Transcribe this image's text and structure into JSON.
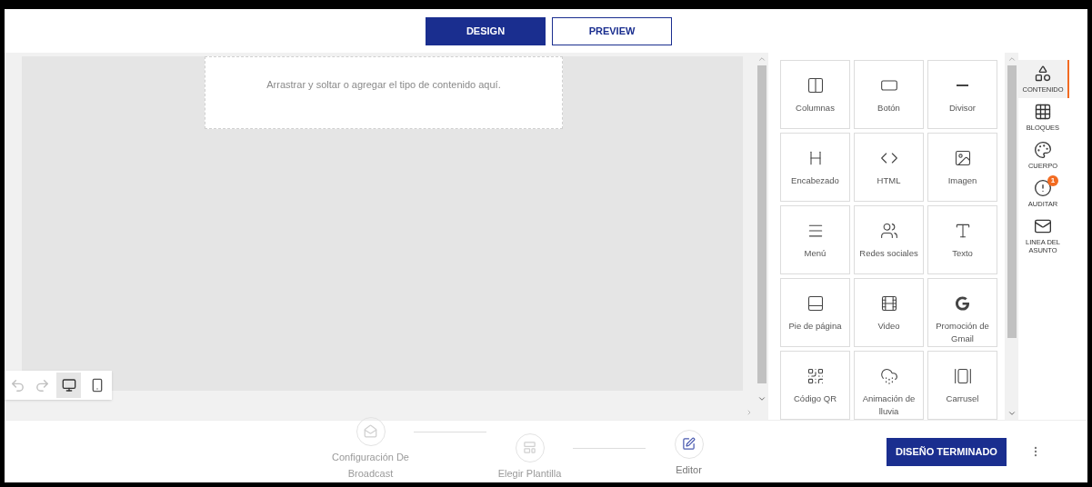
{
  "tabs": [
    {
      "label": "DESIGN",
      "selected": true
    },
    {
      "label": "PREVIEW",
      "selected": false
    }
  ],
  "canvas": {
    "placeholder_text": "Arrastrar y soltar o agregar el tipo de contenido aquí."
  },
  "view_toggle": [
    {
      "selected": true
    },
    {
      "selected": false
    }
  ],
  "content_tiles": [
    {
      "label": "Columnas"
    },
    {
      "label": "Botón"
    },
    {
      "label": "Divisor"
    },
    {
      "label": "Encabezado"
    },
    {
      "label": "HTML"
    },
    {
      "label": "Imagen"
    },
    {
      "label": "Menú"
    },
    {
      "label": "Redes sociales"
    },
    {
      "label": "Texto"
    },
    {
      "label": "Pie de página"
    },
    {
      "label": "Video"
    },
    {
      "label": "Promoción de Gmail"
    },
    {
      "label": "Código QR"
    },
    {
      "label": "Animación de lluvia"
    },
    {
      "label": "Carrusel"
    }
  ],
  "rail": [
    {
      "label": "CONTENIDO",
      "selected": true
    },
    {
      "label": "BLOQUES",
      "selected": false
    },
    {
      "label": "CUERPO",
      "selected": false
    },
    {
      "label": "AUDITAR",
      "selected": false,
      "badge": "1"
    },
    {
      "label": "LINEA DEL ASUNTO",
      "selected": false
    }
  ],
  "steps": [
    {
      "label": "Configuración De Broadcast",
      "selected": false
    },
    {
      "label": "Elegir Plantilla",
      "selected": false
    },
    {
      "label": "Editor",
      "selected": true
    }
  ],
  "finish_button": "DISEÑO TERMINADO"
}
